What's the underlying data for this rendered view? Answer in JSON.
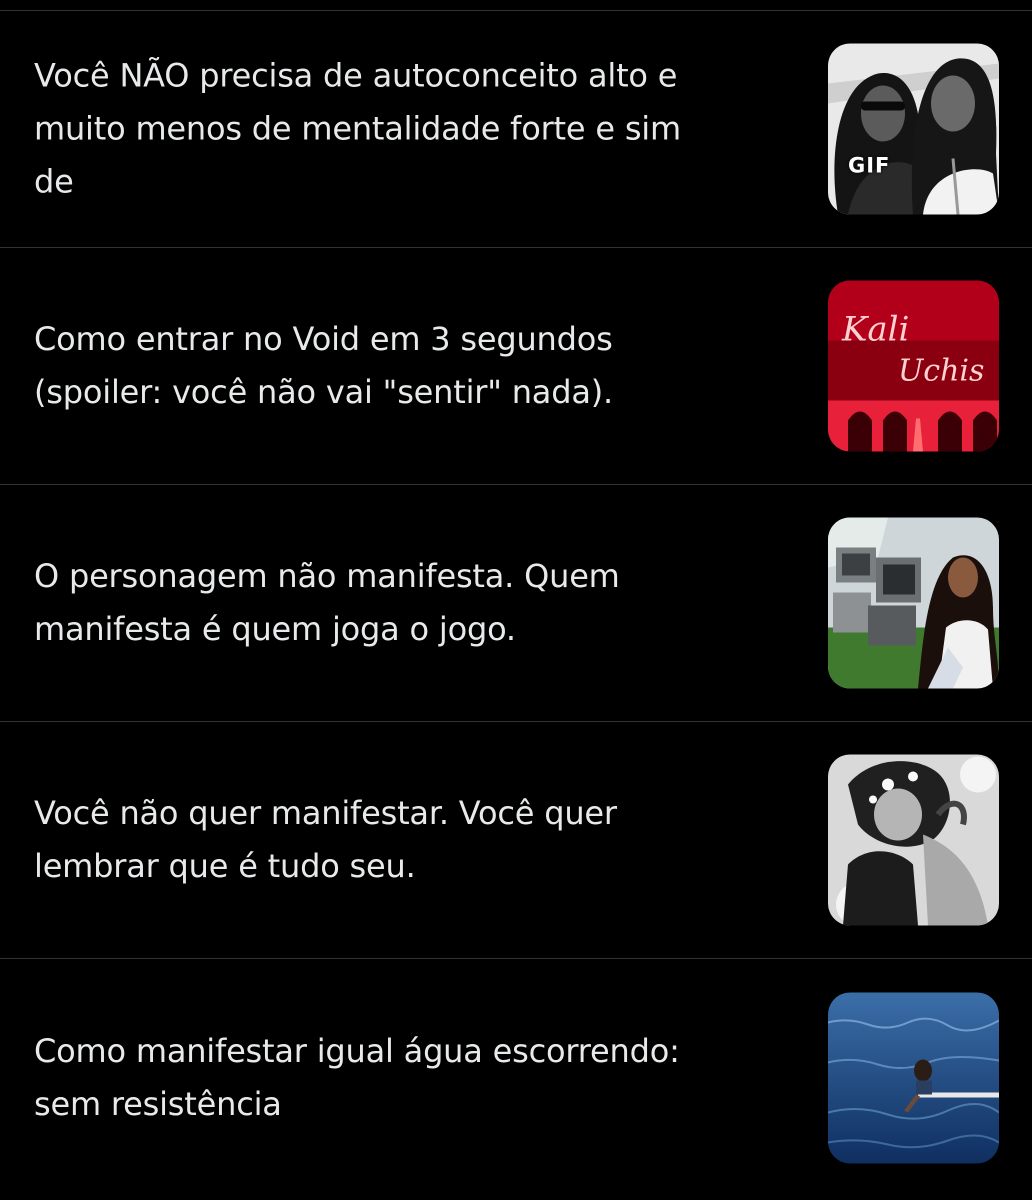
{
  "items": [
    {
      "lines": [
        "Você NÃO precisa de autoconceito alto e",
        "muito menos de mentalidade forte e sim",
        "de"
      ],
      "badge": "GIF"
    },
    {
      "lines": [
        "Como entrar no Void em 3 segundos",
        "(spoiler: você não vai \"sentir\" nada)."
      ],
      "logo_text": [
        "Kali",
        "Uchis"
      ]
    },
    {
      "lines": [
        "O personagem não manifesta. Quem",
        "manifesta é quem joga o jogo."
      ]
    },
    {
      "lines": [
        "Você não quer manifestar. Você quer",
        "lembrar que é tudo seu."
      ]
    },
    {
      "lines": [
        "Como manifestar igual água escorrendo:",
        "sem resistência"
      ]
    }
  ],
  "colors": {
    "background": "#000000",
    "text": "#e7e9ea",
    "divider": "#2f3336"
  }
}
